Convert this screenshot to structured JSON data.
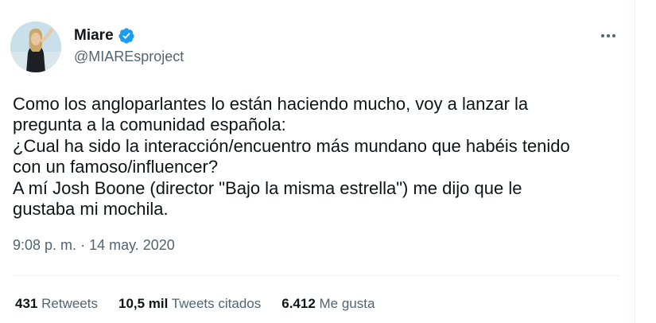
{
  "author": {
    "display_name": "Miare",
    "handle": "@MIAREsproject",
    "verified": true,
    "badge_color": "#1d9bf0"
  },
  "tweet": {
    "text_lines": [
      "Como los angloparlantes lo están haciendo mucho, voy a lanzar la",
      "pregunta a la comunidad española:",
      "¿Cual ha sido la interacción/encuentro más mundano que habéis tenido",
      "con un famoso/influencer?",
      "A mí Josh Boone (director \"Bajo la misma estrella\") me dijo que le",
      "gustaba mi mochila."
    ],
    "time": "9:08 p. m.",
    "separator": "·",
    "date": "14 may. 2020"
  },
  "stats": {
    "retweets_count": "431",
    "retweets_label": "Retweets",
    "quotes_count": "10,5 mil",
    "quotes_label": "Tweets citados",
    "likes_count": "6.412",
    "likes_label": "Me gusta"
  },
  "icons": {
    "verified": "verified-badge-icon",
    "more": "more-options-icon"
  },
  "colors": {
    "text_primary": "#0f1419",
    "text_secondary": "#536471",
    "divider": "#eff3f4",
    "accent": "#1d9bf0"
  }
}
